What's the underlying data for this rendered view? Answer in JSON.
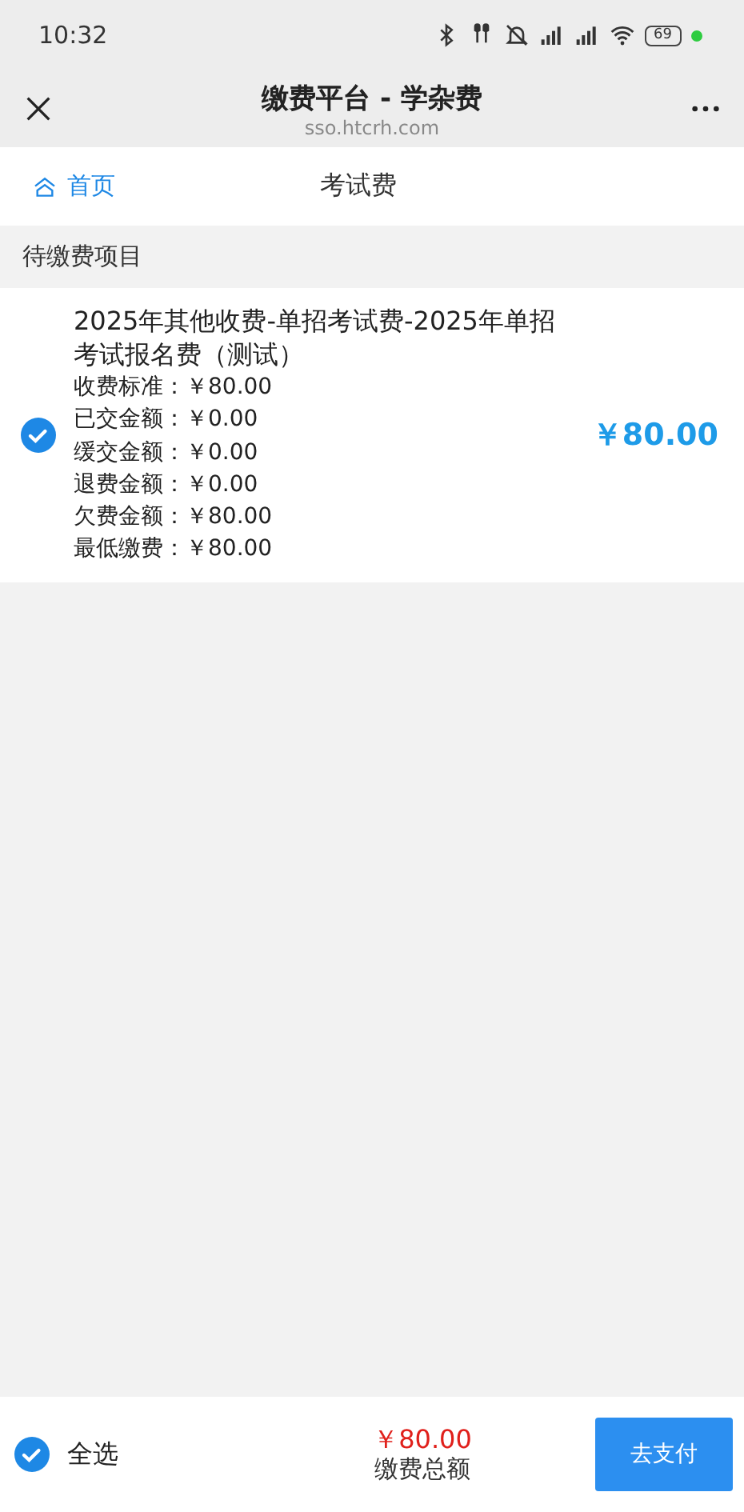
{
  "status_bar": {
    "time": "10:32",
    "battery": "69"
  },
  "window": {
    "title": "缴费平台 - 学杂费",
    "url": "sso.htcrh.com"
  },
  "nav": {
    "home": "首页",
    "title": "考试费"
  },
  "section": {
    "heading": "待缴费项目"
  },
  "items": [
    {
      "title": "2025年其他收费-单招考试费-2025年单招考试报名费（测试）",
      "selected": true,
      "amount": "￥80.00",
      "details": [
        "收费标准：￥80.00",
        "已交金额：￥0.00",
        "缓交金额：￥0.00",
        "退费金额：￥0.00",
        "欠费金额：￥80.00",
        "最低缴费：￥80.00"
      ]
    }
  ],
  "footer": {
    "select_all": {
      "label": "全选",
      "selected": true
    },
    "total": "￥80.00",
    "total_label": "缴费总额",
    "pay_button": "去支付"
  }
}
